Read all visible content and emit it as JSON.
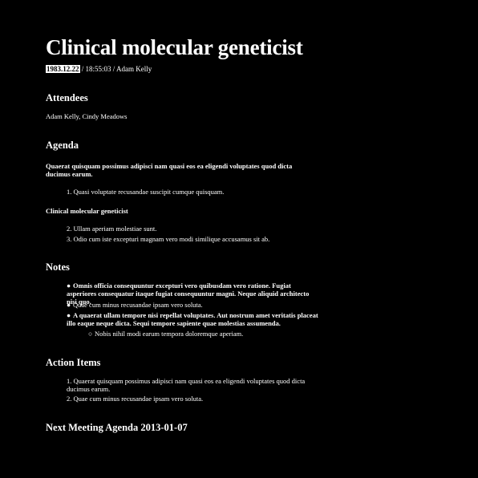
{
  "title": "Clinical molecular geneticist",
  "meta": {
    "date": "1983.12.22",
    "rest": "/ 18:55:03 / Adam Kelly"
  },
  "attendees": {
    "heading": "Attendees",
    "names": "Adam Kelly, Cindy Meadows"
  },
  "agenda": {
    "heading": "Agenda",
    "topic1": "Quaerat quisquam possimus adipisci nam quasi eos ea eligendi voluptates quod dicta ducimus earum.",
    "item1_num": "1.",
    "item1": "Quasi voluptate recusandae suscipit cumque quisquam.",
    "topic2": "Clinical molecular geneticist",
    "item2_num": "2.",
    "item2": "Ullam aperiam molestiae sunt.",
    "item3_num": "3.",
    "item3": "Odio cum iste excepturi magnam vero modi similique accusamus sit ab."
  },
  "notes": {
    "heading": "Notes",
    "bullet1": "Omnis officia consequuntur excepturi vero quibusdam vero ratione. Fugiat asperiores consequatur itaque fugiat consequuntur magni. Neque aliquid architecto nisi quo.",
    "bullet2": "Quae cum minus recusandae ipsam vero soluta.",
    "bullet3": "A quaerat ullam tempore nisi repellat voluptates. Aut nostrum amet veritatis placeat illo eaque neque dicta. Sequi tempore sapiente quae molestias assumenda.",
    "subbullet": "Nobis nihil modi earum tempora doloremque aperiam."
  },
  "action_items": {
    "heading": "Action Items",
    "item1_num": "1.",
    "item1": "Quaerat quisquam possimus adipisci nam quasi eos ea eligendi voluptates quod dicta ducimus earum.",
    "item2_num": "2.",
    "item2": "Quae cum minus recusandae ipsam vero soluta."
  },
  "next_meeting": {
    "heading": "Next Meeting Agenda 2013-01-07"
  }
}
